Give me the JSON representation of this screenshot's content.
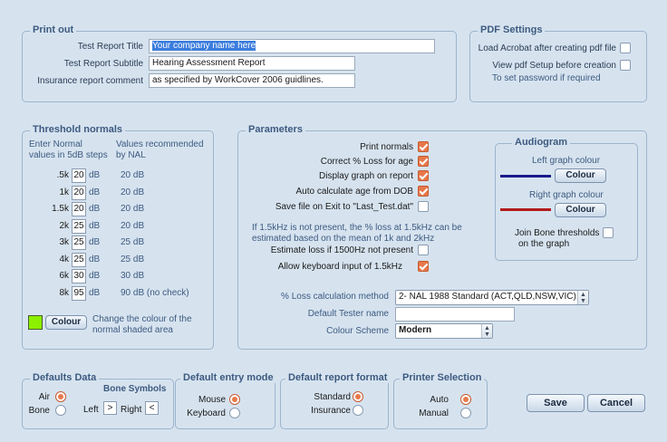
{
  "colors": {
    "left_graph": "#1a1a8c",
    "right_graph": "#b31b1b",
    "normal_shade": "#8cf000",
    "accent": "#e8784a",
    "group_title": "#3d5a80"
  },
  "print_out": {
    "title": "Print out",
    "report_title_label": "Test Report Title",
    "report_title_value": "Your company name here",
    "report_subtitle_label": "Test Report Subtitle",
    "report_subtitle_value": "Hearing Assessment Report",
    "insurance_label": "Insurance report comment",
    "insurance_value": "as specified by WorkCover 2006 guidlines."
  },
  "pdf_settings": {
    "title": "PDF Settings",
    "load_acrobat_label": "Load Acrobat after creating pdf file",
    "view_setup_label": "View pdf Setup before creation",
    "password_note": "To set password if required"
  },
  "threshold": {
    "title": "Threshold normals",
    "enter_header_1": "Enter Normal",
    "enter_header_2": "values in 5dB steps",
    "rec_header_1": "Values recommended",
    "rec_header_2": "by NAL",
    "unit": "dB",
    "rows": [
      {
        "freq": ".5k",
        "value": "20",
        "rec": "20 dB"
      },
      {
        "freq": "1k",
        "value": "20",
        "rec": "20 dB"
      },
      {
        "freq": "1.5k",
        "value": "20",
        "rec": "20 dB"
      },
      {
        "freq": "2k",
        "value": "25",
        "rec": "20 dB"
      },
      {
        "freq": "3k",
        "value": "25",
        "rec": "25 dB"
      },
      {
        "freq": "4k",
        "value": "25",
        "rec": "25 dB"
      },
      {
        "freq": "6k",
        "value": "30",
        "rec": "30 dB"
      },
      {
        "freq": "8k",
        "value": "95",
        "rec": "90 dB (no check)"
      }
    ],
    "colour_button": "Colour",
    "colour_note_1": "Change the colour of the",
    "colour_note_2": "normal shaded area"
  },
  "parameters": {
    "title": "Parameters",
    "print_normals": "Print normals",
    "correct_loss": "Correct % Loss for age",
    "display_graph": "Display graph on report",
    "auto_age": "Auto calculate age from DOB",
    "save_file": "Save file on Exit to \"Last_Test.dat\"",
    "note_1": "If 1.5kHz is not present, the % loss at 1.5kHz can be",
    "note_2": "estimated based on the mean of 1k and 2kHz",
    "estimate_loss": "Estimate loss if 1500Hz not present",
    "allow_keyboard": "Allow keyboard input of 1.5kHz",
    "loss_method_label": "% Loss calculation method",
    "loss_method_value": "2-  NAL 1988  Standard   (ACT,QLD,NSW,VIC)",
    "tester_label": "Default Tester name",
    "tester_value": "",
    "scheme_label": "Colour Scheme",
    "scheme_value": "Modern"
  },
  "audiogram": {
    "title": "Audiogram",
    "left_label": "Left graph colour",
    "left_button": "Colour",
    "right_label": "Right graph colour",
    "right_button": "Colour",
    "join_bone_1": "Join Bone thresholds",
    "join_bone_2": "on the graph"
  },
  "defaults_data": {
    "title": "Defaults Data",
    "air": "Air",
    "bone": "Bone",
    "bone_symbols": "Bone Symbols",
    "left": "Left",
    "left_symbol": ">",
    "right": "Right",
    "right_symbol": "<"
  },
  "entry_mode": {
    "title": "Default entry mode",
    "mouse": "Mouse",
    "keyboard": "Keyboard"
  },
  "report_format": {
    "title": "Default report format",
    "standard": "Standard",
    "insurance": "Insurance"
  },
  "printer": {
    "title": "Printer Selection",
    "auto": "Auto",
    "manual": "Manual"
  },
  "actions": {
    "save": "Save",
    "cancel": "Cancel"
  }
}
